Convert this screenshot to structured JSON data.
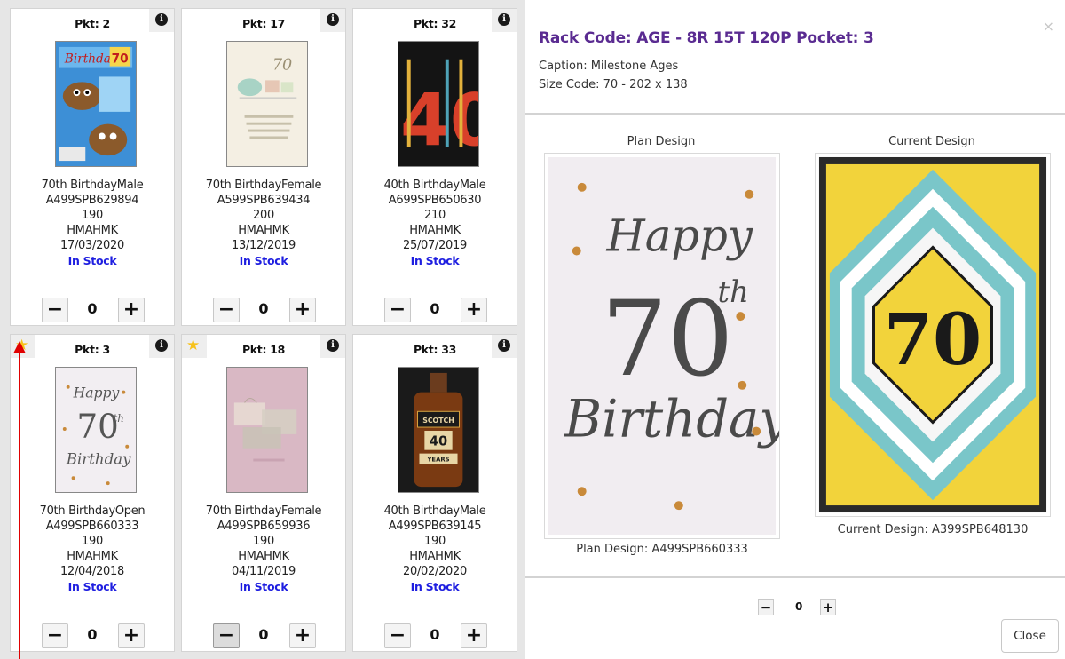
{
  "cards": [
    {
      "pkt": "Pkt: 2",
      "line1": "70th BirthdayMale",
      "code": "A499SPB629894",
      "price": "190",
      "supplier": "HMAHMK",
      "date": "17/03/2020",
      "stock": "In Stock",
      "qty": "0",
      "starred": false
    },
    {
      "pkt": "Pkt: 17",
      "line1": "70th BirthdayFemale",
      "code": "A599SPB639434",
      "price": "200",
      "supplier": "HMAHMK",
      "date": "13/12/2019",
      "stock": "In Stock",
      "qty": "0",
      "starred": false
    },
    {
      "pkt": "Pkt: 32",
      "line1": "40th BirthdayMale",
      "code": "A699SPB650630",
      "price": "210",
      "supplier": "HMAHMK",
      "date": "25/07/2019",
      "stock": "In Stock",
      "qty": "0",
      "starred": false
    },
    {
      "pkt": "Pkt: 3",
      "line1": "70th BirthdayOpen",
      "code": "A499SPB660333",
      "price": "190",
      "supplier": "HMAHMK",
      "date": "12/04/2018",
      "stock": "In Stock",
      "qty": "0",
      "starred": true
    },
    {
      "pkt": "Pkt: 18",
      "line1": "70th BirthdayFemale",
      "code": "A499SPB659936",
      "price": "190",
      "supplier": "HMAHMK",
      "date": "04/11/2019",
      "stock": "In Stock",
      "qty": "0",
      "starred": true
    },
    {
      "pkt": "Pkt: 33",
      "line1": "40th BirthdayMale",
      "code": "A499SPB639145",
      "price": "190",
      "supplier": "HMAHMK",
      "date": "20/02/2020",
      "stock": "In Stock",
      "qty": "0",
      "starred": false
    }
  ],
  "icons": {
    "info": "info-icon",
    "star": "star-icon",
    "minus": "minus-icon",
    "plus": "plus-icon",
    "close": "close-icon"
  },
  "symbols": {
    "info": "i",
    "star": "★",
    "minus": "−",
    "plus": "+",
    "close": "×"
  },
  "modal": {
    "title": "Rack Code: AGE - 8R 15T 120P Pocket: 3",
    "caption": "Caption: Milestone Ages",
    "size_code": "Size Code: 70 - 202 x 138",
    "plan_label": "Plan Design",
    "current_label": "Current Design",
    "plan_code": "Plan Design: A499SPB660333",
    "current_code": "Current Design: A399SPB648130",
    "qty": "0",
    "close_label": "Close"
  },
  "card_art": {
    "pkt2_text": "Birthday",
    "pkt2_number": "70",
    "pkt17_number": "70",
    "pkt32_number": "40",
    "pkt3_lines": [
      "Happy",
      "70",
      "th",
      "Birthday"
    ],
    "pkt33_label": "SCOTCH",
    "pkt33_number": "40",
    "pkt33_years": "YEARS",
    "plan_lines": [
      "Happy",
      "70",
      "th",
      "Birthday"
    ],
    "current_number": "70"
  },
  "colors": {
    "title_purple": "#5a2b91",
    "stock_blue": "#1e1ee0",
    "star_yellow": "#f7c21a",
    "annotation_red": "#e00000"
  }
}
